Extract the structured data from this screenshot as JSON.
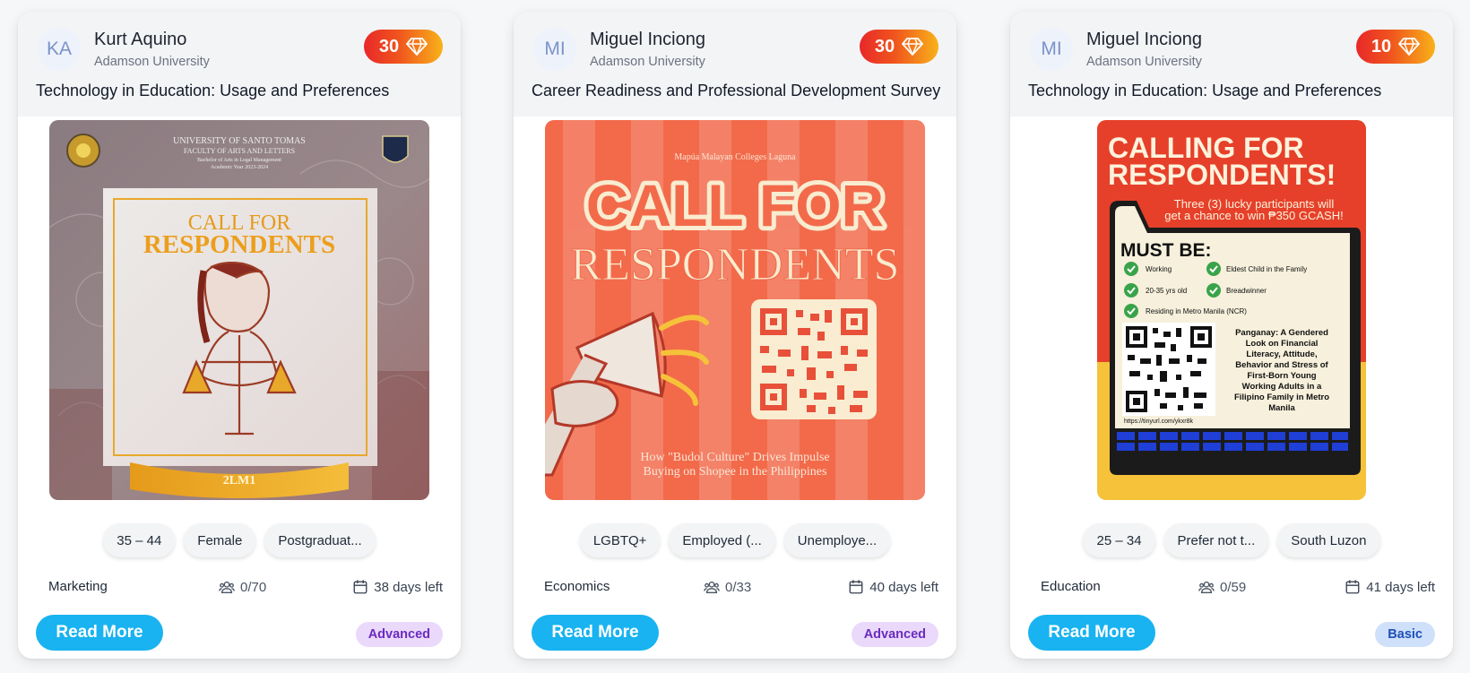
{
  "cards": [
    {
      "author": {
        "initials": "KA",
        "name": "Kurt Aquino",
        "university": "Adamson University"
      },
      "points": "30",
      "title": "Technology in Education: Usage and Preferences",
      "poster": {
        "header_line1": "UNIVERSITY OF SANTO TOMAS",
        "header_line2": "FACULTY OF ARTS AND LETTERS",
        "header_line3": "Bachelor of Arts in Legal Management",
        "header_line4": "Academic Year 2023-2024",
        "headline1": "CALL FOR",
        "headline2": "RESPONDENTS",
        "badge": "2LM1"
      },
      "tags": [
        "35 – 44",
        "Female",
        "Postgraduat..."
      ],
      "field": "Marketing",
      "respondents": "0/70",
      "days_left": "38 days left",
      "button": "Read More",
      "level": "Advanced"
    },
    {
      "author": {
        "initials": "MI",
        "name": "Miguel Inciong",
        "university": "Adamson University"
      },
      "points": "30",
      "title": "Career Readiness and Professional Development Survey",
      "poster": {
        "top": "Mapúa Malayan Colleges Laguna",
        "headline1": "CALL FOR",
        "headline2": "RESPONDENTS",
        "caption1": "How \"Budol Culture\" Drives Impulse",
        "caption2": "Buying on Shopee in the Philippines"
      },
      "tags": [
        "LGBTQ+",
        "Employed (...",
        "Unemploye..."
      ],
      "field": "Economics",
      "respondents": "0/33",
      "days_left": "40 days left",
      "button": "Read More",
      "level": "Advanced"
    },
    {
      "author": {
        "initials": "MI",
        "name": "Miguel Inciong",
        "university": "Adamson University"
      },
      "points": "10",
      "title": "Technology in Education: Usage and Preferences",
      "poster": {
        "headline1": "CALLING FOR",
        "headline2": "RESPONDENTS!",
        "prize1": "Three (3) lucky participants will",
        "prize2": "get a chance to win ₱350 GCASH!",
        "must_be": "MUST BE:",
        "req1": "Working",
        "req2": "Eldest Child in the Family",
        "req3": "20-35 yrs old",
        "req4": "Breadwinner",
        "req5": "Residing in Metro Manila (NCR)",
        "study1": "Panganay: A Gendered",
        "study2": "Look on Financial",
        "study3": "Literacy, Attitude,",
        "study4": "Behavior and Stress of",
        "study5": "First-Born Young",
        "study6": "Working Adults in a",
        "study7": "Filipino Family in Metro",
        "study8": "Manila",
        "link": "https://tinyurl.com/ykxr8k"
      },
      "tags": [
        "25 – 34",
        "Prefer not t...",
        "South Luzon"
      ],
      "field": "Education",
      "respondents": "0/59",
      "days_left": "41 days left",
      "button": "Read More",
      "level": "Basic"
    }
  ],
  "colors": {
    "accent": "#18b3f0",
    "advanced_bg": "#ead9fb",
    "advanced_text": "#6b2bbf",
    "basic_bg": "#cfe0fb",
    "basic_text": "#1d4fb8"
  },
  "icons": {
    "points": "gem-icon",
    "respondents": "users-icon",
    "deadline": "calendar-icon"
  }
}
